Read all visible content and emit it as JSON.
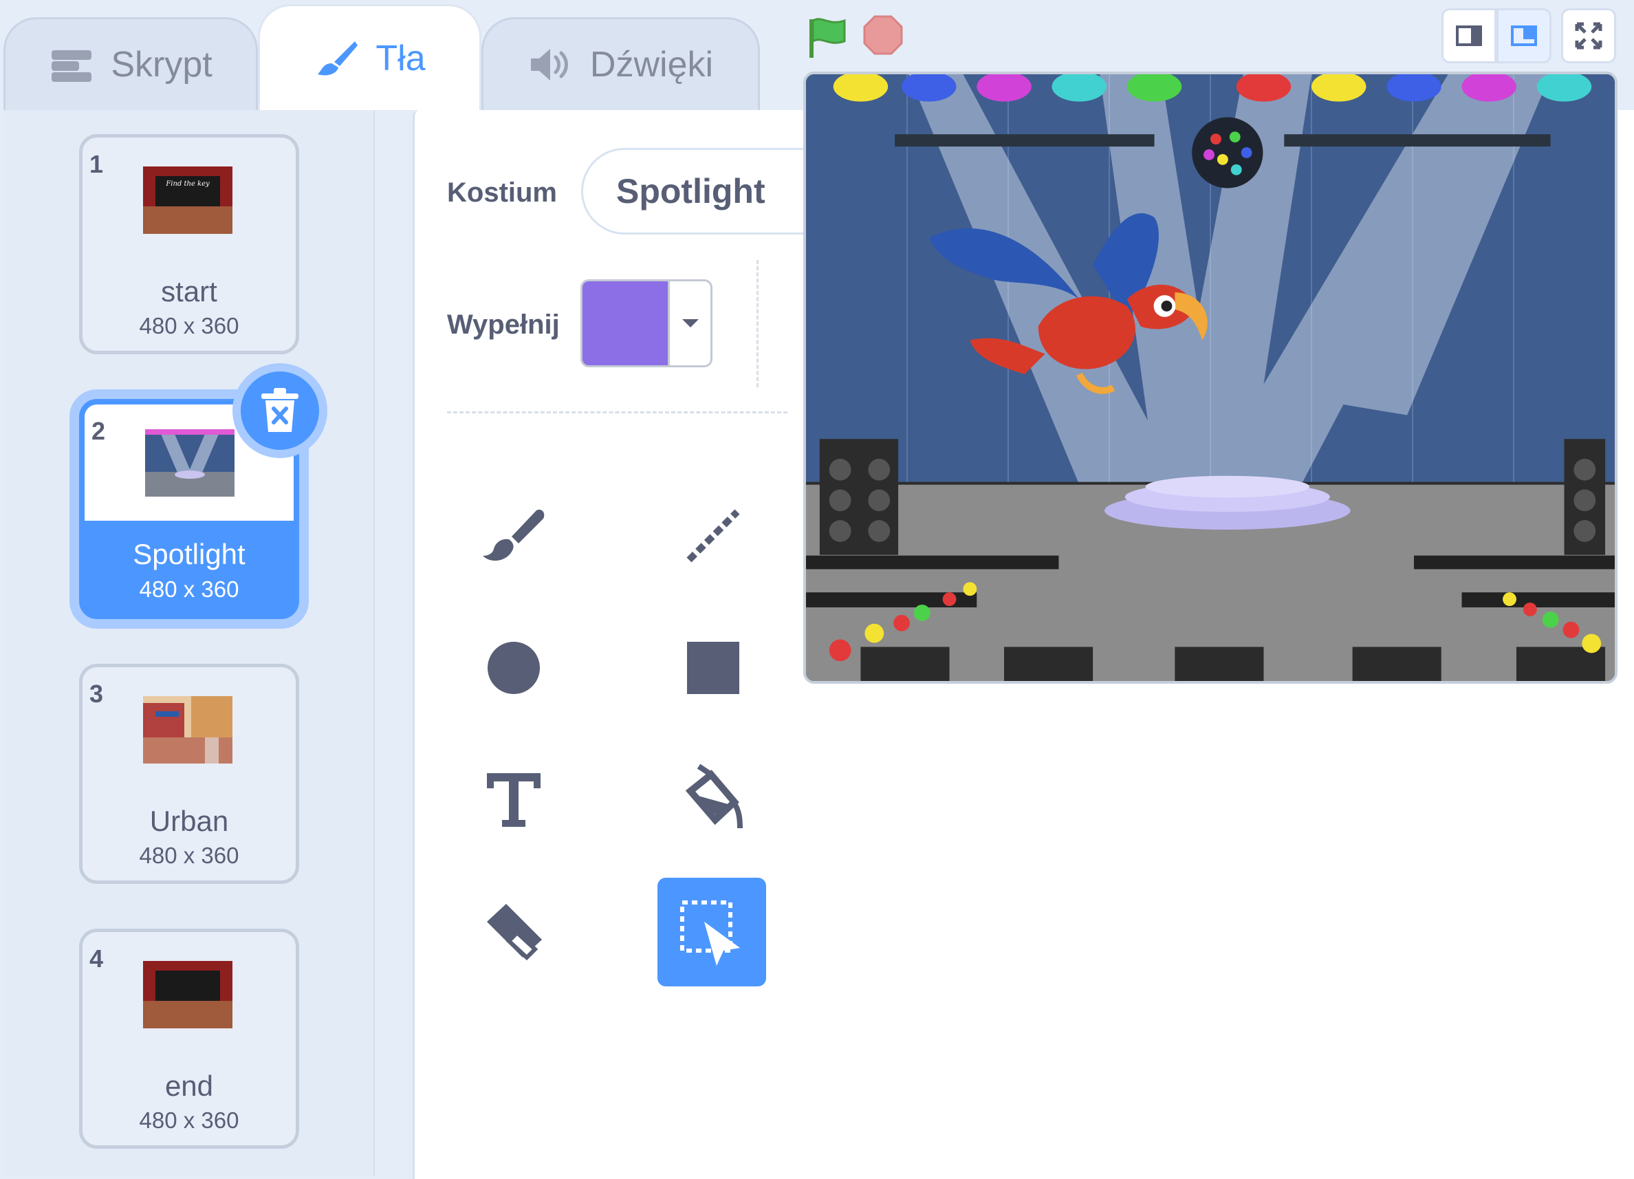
{
  "tabs": {
    "code_label": "Skrypt",
    "backdrops_label": "Tła",
    "sounds_label": "Dźwięki"
  },
  "backdrops": [
    {
      "number": "1",
      "name": "start",
      "size": "480 x 360",
      "selected": false
    },
    {
      "number": "2",
      "name": "Spotlight",
      "size": "480 x 360",
      "selected": true
    },
    {
      "number": "3",
      "name": "Urban",
      "size": "480 x 360",
      "selected": false
    },
    {
      "number": "4",
      "name": "end",
      "size": "480 x 360",
      "selected": false
    }
  ],
  "editor": {
    "costume_label": "Kostium",
    "costume_name": "Spotlight",
    "fill_label": "Wypełnij",
    "fill_color": "#8c6ee6",
    "tools": [
      "brush-tool",
      "line-tool",
      "circle-tool",
      "rectangle-tool",
      "text-tool",
      "fill-tool",
      "eraser-tool",
      "select-tool"
    ],
    "active_tool": "select-tool"
  },
  "stage": {
    "controls": [
      "green-flag-icon",
      "stop-icon"
    ],
    "views": [
      "small-stage-icon",
      "normal-stage-icon",
      "fullscreen-icon"
    ],
    "colors": {
      "accent": "#4c97ff",
      "flag": "#4cbf56",
      "stop": "#e89a9a"
    }
  }
}
